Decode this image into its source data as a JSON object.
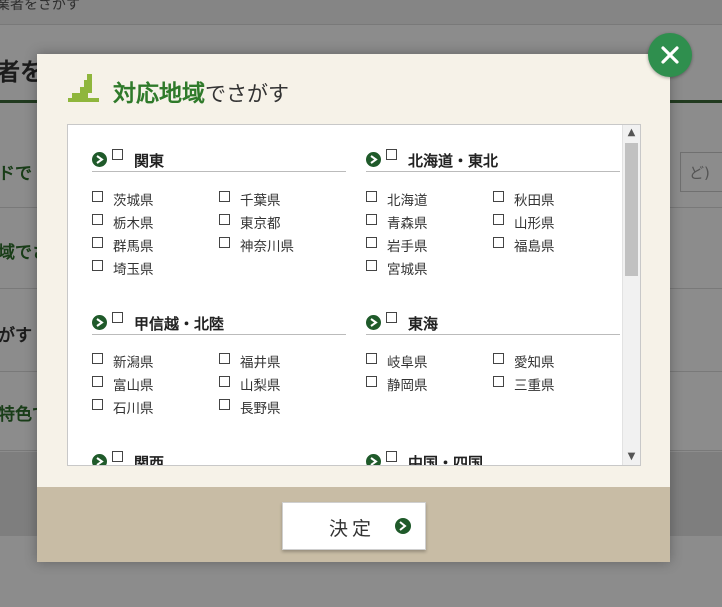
{
  "background": {
    "top_text": "業者をさがす",
    "heading": "者を",
    "rows": [
      "ドで",
      "域でさ",
      "がす",
      "特色で"
    ],
    "input_hint": "ど)"
  },
  "modal": {
    "title_accent": "対応地域",
    "title_rest": "でさがす",
    "map_icon": "japan-map-icon",
    "close_icon": "close-icon",
    "regions": [
      {
        "name": "関東",
        "prefs": [
          "茨城県",
          "千葉県",
          "栃木県",
          "東京都",
          "群馬県",
          "神奈川県",
          "埼玉県"
        ]
      },
      {
        "name": "北海道・東北",
        "prefs": [
          "北海道",
          "秋田県",
          "青森県",
          "山形県",
          "岩手県",
          "福島県",
          "宮城県"
        ]
      },
      {
        "name": "甲信越・北陸",
        "prefs": [
          "新潟県",
          "福井県",
          "富山県",
          "山梨県",
          "石川県",
          "長野県"
        ]
      },
      {
        "name": "東海",
        "prefs": [
          "岐阜県",
          "愛知県",
          "静岡県",
          "三重県"
        ]
      },
      {
        "name": "関西",
        "prefs": []
      },
      {
        "name": "中国・四国",
        "prefs": []
      }
    ],
    "decide_label": "決定"
  },
  "colors": {
    "accent": "#2f7a2a",
    "close": "#2f8f4e",
    "footer": "#c8bca5",
    "modal_bg": "#f6f2e8"
  }
}
